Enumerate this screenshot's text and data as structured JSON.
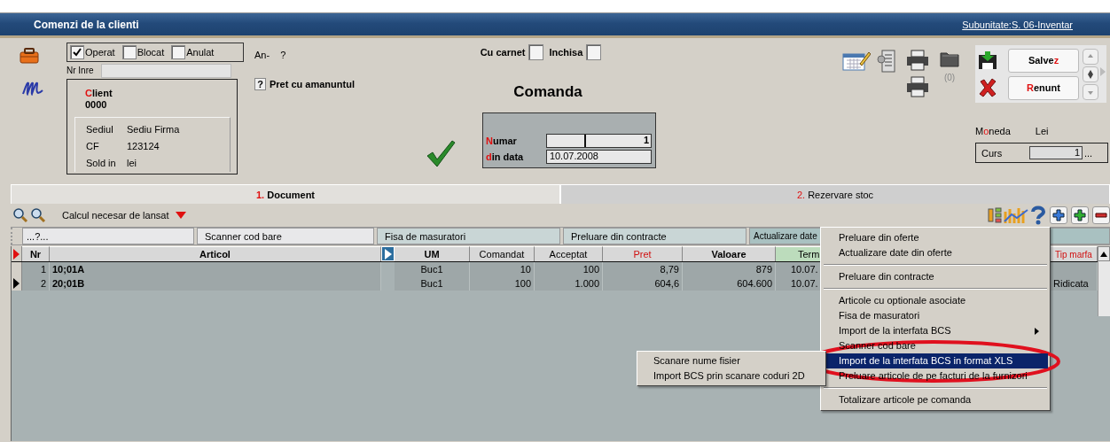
{
  "window": {
    "title": "Comenzi de la clienti",
    "subunit_link": "Subunitate:S. 06-Inventar"
  },
  "status_checks": [
    {
      "label": "Operat",
      "checked": true
    },
    {
      "label": "Blocat",
      "checked": false
    },
    {
      "label": "Anulat",
      "checked": false
    }
  ],
  "nr_inre": {
    "label": "Nr Inre"
  },
  "an": {
    "label": "An-",
    "value": "?"
  },
  "client": {
    "label": {
      "key": "C",
      "post": "lient"
    },
    "code": "0000",
    "details": [
      {
        "label": "Sediul",
        "value": "Sediu Firma"
      },
      {
        "label": "CF",
        "value": "123124"
      },
      {
        "label": "Sold in",
        "value": "lei"
      }
    ]
  },
  "pret_amanuntul": {
    "flag": "?",
    "label": "Pret cu amanuntul"
  },
  "flags": [
    {
      "label": "Cu carnet",
      "checked": false
    },
    {
      "label": "Inchisa",
      "checked": false
    }
  ],
  "doc_title": "Comanda",
  "numar": {
    "label": {
      "key": "N",
      "post": "umar"
    },
    "value": "1"
  },
  "din_data": {
    "label": {
      "key": "d",
      "post": "in data"
    },
    "value": "10.07.2008"
  },
  "print_count": "(0)",
  "buttons": [
    {
      "kind": "save",
      "label": {
        "pre": "Salve",
        "key": "z"
      }
    },
    {
      "kind": "cancel",
      "label": {
        "key": "R",
        "post": "enunt"
      }
    }
  ],
  "moneda": {
    "label": {
      "pre": "M",
      "key": "o",
      "post": "neda"
    },
    "value": "Lei"
  },
  "curs": {
    "label": "Curs",
    "value": "1",
    "more": "..."
  },
  "tabs": [
    {
      "label": {
        "key": "1.",
        "post": " Document"
      },
      "selected": true
    },
    {
      "label": {
        "key": "2.",
        "post": " Rezervare stoc"
      },
      "selected": false
    }
  ],
  "toolbar": {
    "calc_label": "Calcul necesar de lansat"
  },
  "quick_buttons": [
    {
      "label": "...?...",
      "kind": "light"
    },
    {
      "label": "Scanner cod bare",
      "kind": "light"
    },
    {
      "label": "Fisa de masuratori",
      "kind": "tinted"
    },
    {
      "label": "Preluare din contracte",
      "kind": "tinted"
    },
    {
      "label": "Actualizare date",
      "kind": "dark"
    }
  ],
  "table": {
    "columns": [
      {
        "label": "Nr",
        "kind": "bold"
      },
      {
        "label": "Articol",
        "kind": "bold"
      },
      {
        "label": "UM",
        "kind": "bold"
      },
      {
        "label": "Comandat",
        "kind": "plain"
      },
      {
        "label": "Acceptat",
        "kind": "plain"
      },
      {
        "label": "Pret",
        "kind": "red"
      },
      {
        "label": "Valoare",
        "kind": "bold"
      },
      {
        "label": "Term",
        "kind": "green"
      },
      {
        "label": "Tip marfa",
        "kind": "red"
      }
    ],
    "rows": [
      {
        "selected": false,
        "cells": [
          "1",
          "10;01A",
          "Buc1",
          "10",
          "100",
          "8,79",
          "879",
          "10.07."
        ]
      },
      {
        "selected": true,
        "cells": [
          "2",
          "20;01B",
          "Buc1",
          "100",
          "1.000",
          "604,6",
          "604.600",
          "10.07.",
          "Ridicata"
        ]
      }
    ]
  },
  "context_menu": {
    "groups": [
      [
        {
          "label": "Preluare din oferte",
          "selected": false,
          "submenu": false
        },
        {
          "label": "Actualizare date din oferte",
          "selected": false,
          "submenu": false
        }
      ],
      [
        {
          "label": "Preluare din contracte",
          "selected": false,
          "submenu": false
        }
      ],
      [
        {
          "label": "Articole cu optionale asociate",
          "selected": false,
          "submenu": false
        },
        {
          "label": "Fisa de masuratori",
          "selected": false,
          "submenu": false
        },
        {
          "label": "Import de la interfata BCS",
          "selected": false,
          "submenu": true
        },
        {
          "label": "Scanner cod bare",
          "selected": false,
          "submenu": false
        },
        {
          "label": "Import de la interfata BCS in format XLS",
          "selected": true,
          "submenu": false
        },
        {
          "label": "Preluare articole de pe facturi de la furnizori",
          "selected": false,
          "submenu": false
        }
      ],
      [
        {
          "label": "Totalizare articole pe comanda",
          "selected": false,
          "submenu": false
        }
      ]
    ]
  },
  "submenu": {
    "items": [
      {
        "label": "Scanare nume fisier"
      },
      {
        "label": "Import BCS prin scanare coduri 2D"
      }
    ]
  },
  "highlight_annotation": true
}
